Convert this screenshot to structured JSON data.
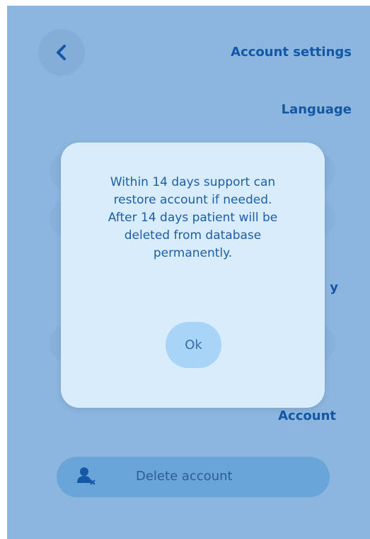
{
  "header": {
    "back_icon": "chevron-left-icon",
    "title": "Account settings"
  },
  "sections": {
    "language": "Language",
    "privacy_partial": "y",
    "account": "Account"
  },
  "account": {
    "delete_label": "Delete account",
    "delete_icon": "person-remove-icon"
  },
  "modal": {
    "message_lines": [
      "Within 14 days support can",
      "restore account if needed.",
      "After 14 days patient will be",
      "deleted from database",
      "permanently."
    ],
    "ok_label": "Ok"
  },
  "colors": {
    "background": "#8cb6dd",
    "primary_text": "#1357a6",
    "modal_background": "#d9ecfb",
    "button": "#a8d4f8"
  }
}
